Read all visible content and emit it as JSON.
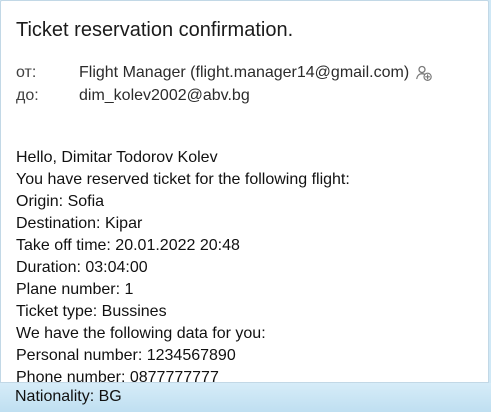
{
  "email": {
    "subject": "Ticket reservation confirmation.",
    "from_label": "от:",
    "from_value": "Flight Manager (flight.manager14@gmail.com)",
    "to_label": "до:",
    "to_value": "dim_kolev2002@abv.bg",
    "add_contact_icon": "add-contact-icon",
    "body_lines": [
      "Hello, Dimitar Todorov Kolev",
      "You have reserved ticket for the following flight:",
      "Origin: Sofia",
      "Destination: Kipar",
      "Take off time: 20.01.2022 20:48",
      "Duration: 03:04:00",
      "Plane number: 1",
      "Ticket type: Bussines",
      "We have the following data for you:",
      "Personal number: 1234567890",
      "Phone number: 0877777777"
    ],
    "nationality_line": "Nationality: BG"
  }
}
